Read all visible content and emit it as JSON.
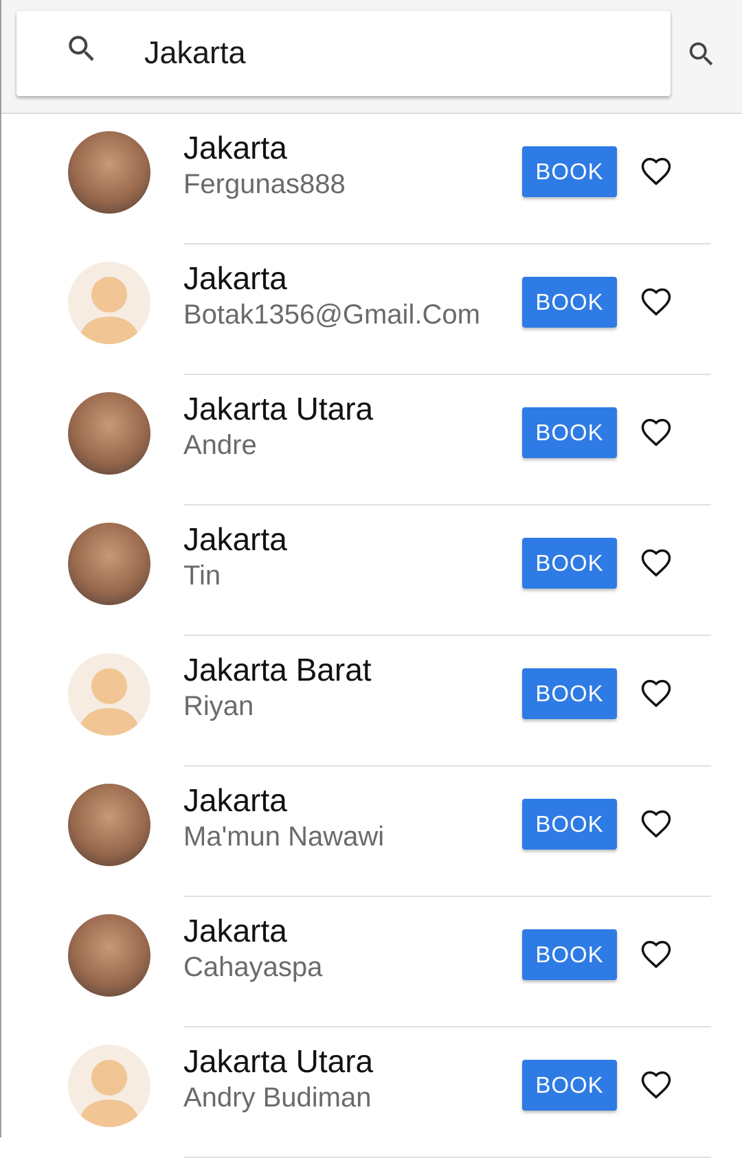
{
  "search": {
    "query": "Jakarta"
  },
  "colors": {
    "accent": "#2f7be5",
    "divider": "#e0e0e0"
  },
  "results": [
    {
      "location": "Jakarta",
      "name": "Fergunas888",
      "avatar": "photo",
      "button": "BOOK"
    },
    {
      "location": "Jakarta",
      "name": "Botak1356@Gmail.Com",
      "avatar": "default",
      "button": "BOOK"
    },
    {
      "location": "Jakarta Utara",
      "name": "Andre",
      "avatar": "photo",
      "button": "BOOK"
    },
    {
      "location": "Jakarta",
      "name": "Tin",
      "avatar": "photo",
      "button": "BOOK"
    },
    {
      "location": "Jakarta Barat",
      "name": "Riyan",
      "avatar": "default",
      "button": "BOOK"
    },
    {
      "location": "Jakarta",
      "name": "Ma'mun Nawawi",
      "avatar": "photo",
      "button": "BOOK"
    },
    {
      "location": "Jakarta",
      "name": "Cahayaspa",
      "avatar": "photo",
      "button": "BOOK"
    },
    {
      "location": "Jakarta Utara",
      "name": "Andry Budiman",
      "avatar": "default",
      "button": "BOOK"
    }
  ]
}
